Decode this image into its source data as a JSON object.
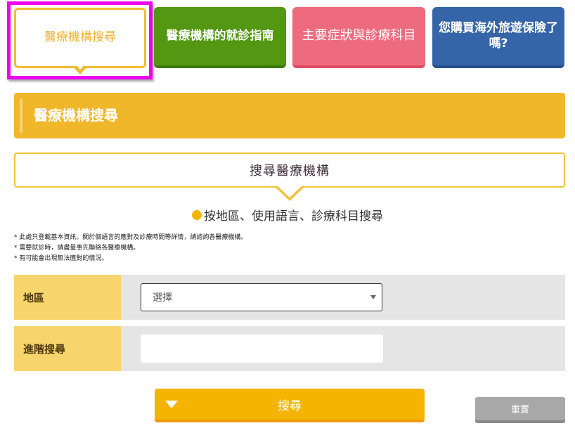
{
  "tabs": [
    {
      "label": "醫療機構搜尋",
      "active": true,
      "color": "#f0bd32"
    },
    {
      "label": "醫療機構的就診指南",
      "active": false,
      "color": "#539712"
    },
    {
      "label": "主要症狀與診療科目",
      "active": false,
      "color": "#ee6b7d"
    },
    {
      "label": "您購買海外旅遊保險了嗎?",
      "active": false,
      "color": "#3565a8"
    }
  ],
  "section": {
    "title": "醫療機構搜尋"
  },
  "search_box": {
    "title": "搜尋醫療機構"
  },
  "search_by": {
    "label": "按地區、使用語言、診療科目搜尋"
  },
  "notes": [
    "* 此處只登載基本資訊。關於個語言的應對及診療時間等詳情，請諮詢各醫療機構。",
    "* 需要就診時，請盡量事先聯絡各醫療機構。",
    "* 有可能會出現無法應對的情況。"
  ],
  "form": {
    "region": {
      "label": "地區",
      "selected": "選擇"
    },
    "advanced": {
      "label": "進階搜尋",
      "value": "",
      "placeholder": ""
    }
  },
  "buttons": {
    "search": "搜尋",
    "reset": "重置"
  },
  "colors": {
    "accent": "#f1b72a",
    "search_button": "#f4b400",
    "reset_button": "#a8a8a8",
    "highlight_border": "#ee00ee"
  }
}
